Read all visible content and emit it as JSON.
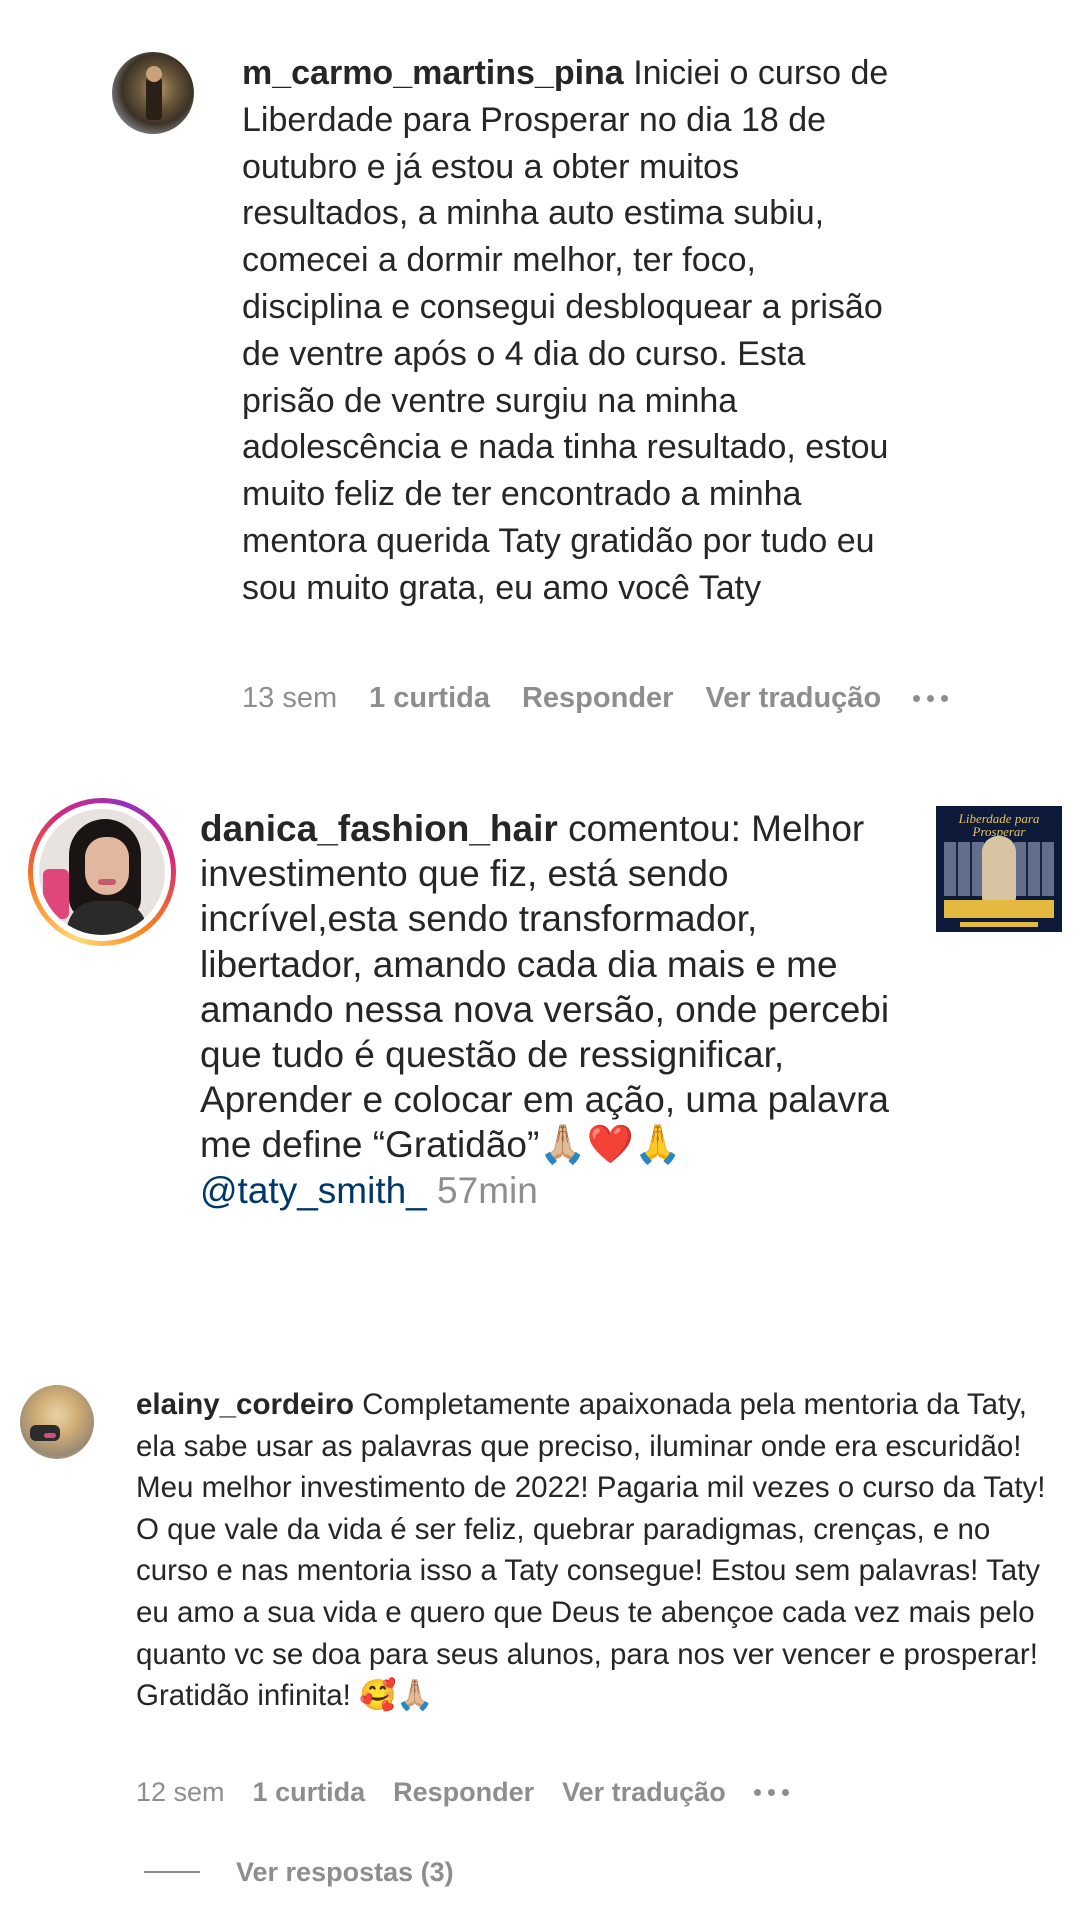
{
  "comment1": {
    "username": "m_carmo_martins_pina",
    "text": "Iniciei o curso de Liberdade para Prosperar no dia 18 de outubro e já estou a obter muitos resultados, a minha auto estima subiu, comecei a dormir melhor, ter foco, disciplina e consegui desbloquear a prisão de ventre após o 4 dia do curso. Esta prisão de ventre surgiu na minha adolescência e nada tinha resultado, estou muito feliz de ter encontrado a minha mentora querida Taty gratidão por tudo eu sou muito grata, eu amo você Taty",
    "time": "13 sem",
    "likes": "1 curtida",
    "reply": "Responder",
    "translate": "Ver tradução"
  },
  "comment2": {
    "username": "danica_fashion_hair",
    "action": "comentou:",
    "text": "Melhor investimento que fiz, está sendo incrível,esta sendo transformador, libertador, amando cada dia mais e me amando nessa nova versão, onde percebi que tudo é questão de ressignificar, Aprender e colocar em ação, uma palavra me define “Gratidão”",
    "emojis": "🙏🏼❤️🙏",
    "mention": "@taty_smith_",
    "time": "57min",
    "thumbnail_title": "Liberdade para Prosperar",
    "thumbnail_band": "CONQUISTE PROSPERIDADE PROFISSIONAL E PESSOAL"
  },
  "comment3": {
    "username": "elainy_cordeiro",
    "text": "Completamente apaixonada pela mentoria da Taty, ela sabe usar as palavras que preciso, iluminar onde era escuridão! Meu melhor investimento de 2022! Pagaria mil vezes o curso da Taty! O que vale da vida é ser feliz, quebrar paradigmas, crenças, e no curso e nas mentoria isso a Taty consegue! Estou sem palavras! Taty eu amo a sua vida e quero que Deus te abençoe cada vez mais pelo quanto vc se doa para seus alunos, para nos ver vencer e prosperar! Gratidão infinita!",
    "emojis": "🥰🙏🏼",
    "time": "12 sem",
    "likes": "1 curtida",
    "reply": "Responder",
    "translate": "Ver tradução"
  },
  "view_replies": "Ver respostas (3)",
  "icons": {
    "more": "more-horizontal-icon"
  }
}
